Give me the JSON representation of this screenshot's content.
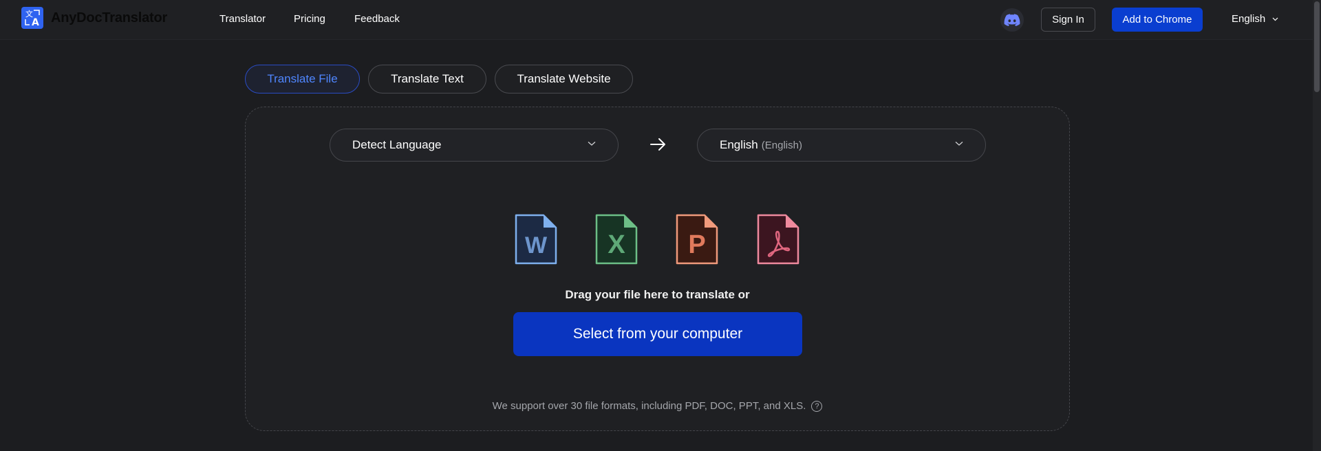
{
  "header": {
    "logo_text": "AnyDocTranslator",
    "nav": [
      "Translator",
      "Pricing",
      "Feedback"
    ],
    "sign_in": "Sign In",
    "add_to_chrome": "Add to Chrome",
    "language": "English"
  },
  "tabs": [
    {
      "label": "Translate File",
      "active": true
    },
    {
      "label": "Translate Text",
      "active": false
    },
    {
      "label": "Translate Website",
      "active": false
    }
  ],
  "source_language": {
    "label": "Detect Language"
  },
  "target_language": {
    "label": "English",
    "native": "(English)"
  },
  "file_icons": [
    {
      "name": "word-file-icon",
      "letter": "W",
      "color": "#7fb0ee",
      "fill": "#1c2a44"
    },
    {
      "name": "excel-file-icon",
      "letter": "X",
      "color": "#6dbf87",
      "fill": "#173424"
    },
    {
      "name": "powerpoint-file-icon",
      "letter": "P",
      "color": "#f09a7c",
      "fill": "#3a1a12"
    },
    {
      "name": "pdf-file-icon",
      "letter": "",
      "color": "#ef8a9e",
      "fill": "#3c1520"
    }
  ],
  "drag_text": "Drag your file here to translate or",
  "select_button": "Select from your computer",
  "support_text": "We support over 30 file formats, including PDF, DOC, PPT, and XLS.",
  "help_glyph": "?",
  "colors": {
    "accent": "#0a3ed0",
    "active_tab": "#4f86ff",
    "background": "#1c1d20"
  }
}
